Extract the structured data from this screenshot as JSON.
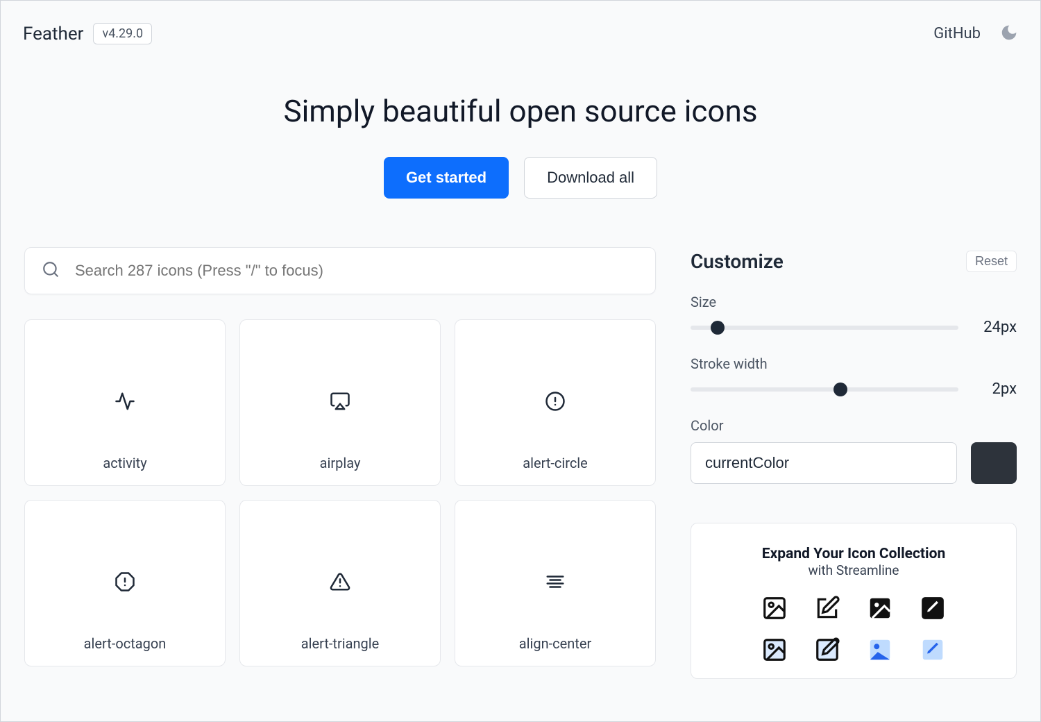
{
  "header": {
    "logo": "Feather",
    "version": "v4.29.0",
    "github": "GitHub"
  },
  "hero": {
    "title": "Simply beautiful open source icons",
    "get_started": "Get started",
    "download_all": "Download all"
  },
  "search": {
    "placeholder": "Search 287 icons (Press \"/\" to focus)"
  },
  "icons": [
    {
      "name": "activity"
    },
    {
      "name": "airplay"
    },
    {
      "name": "alert-circle"
    },
    {
      "name": "alert-octagon"
    },
    {
      "name": "alert-triangle"
    },
    {
      "name": "align-center"
    }
  ],
  "customize": {
    "title": "Customize",
    "reset": "Reset",
    "size_label": "Size",
    "size_value": "24px",
    "size_percent": 10,
    "stroke_label": "Stroke width",
    "stroke_value": "2px",
    "stroke_percent": 56,
    "color_label": "Color",
    "color_value": "currentColor",
    "color_swatch": "#2d333b"
  },
  "promo": {
    "title": "Expand Your Icon Collection",
    "subtitle": "with Streamline"
  }
}
